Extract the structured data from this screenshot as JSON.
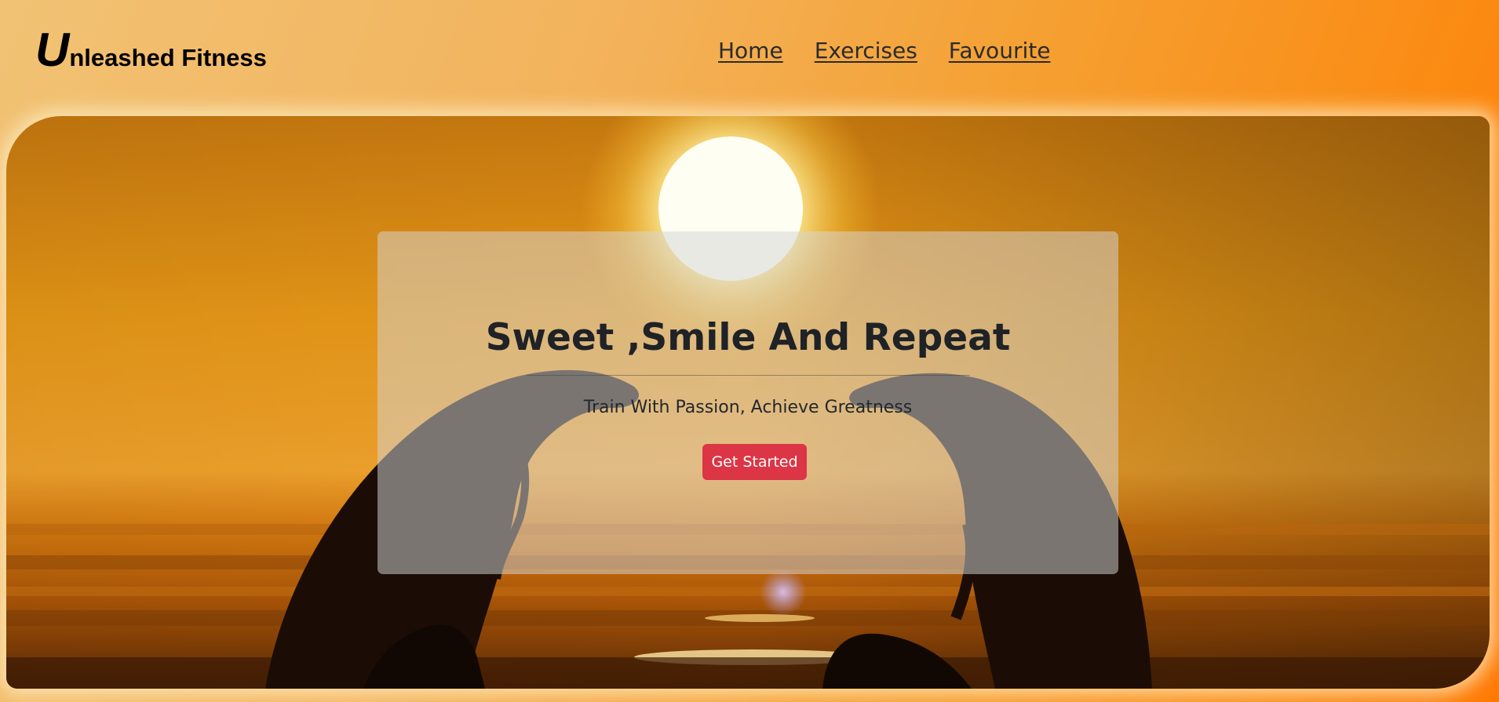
{
  "brand": {
    "initial": "U",
    "rest": "nleashed Fitness"
  },
  "nav": {
    "items": [
      {
        "label": "Home"
      },
      {
        "label": "Exercises"
      },
      {
        "label": "Favourite"
      }
    ]
  },
  "hero": {
    "image_icon": "sunset-yoga-photo",
    "title": "Sweet ,Smile And Repeat",
    "subtitle": "Train With Passion, Achieve Greatness",
    "cta_label": "Get Started"
  },
  "colors": {
    "page_bg_start": "#f1c274",
    "page_bg_end": "#ff7a05",
    "cta": "#dc3545",
    "text_dark": "#1f2226"
  }
}
